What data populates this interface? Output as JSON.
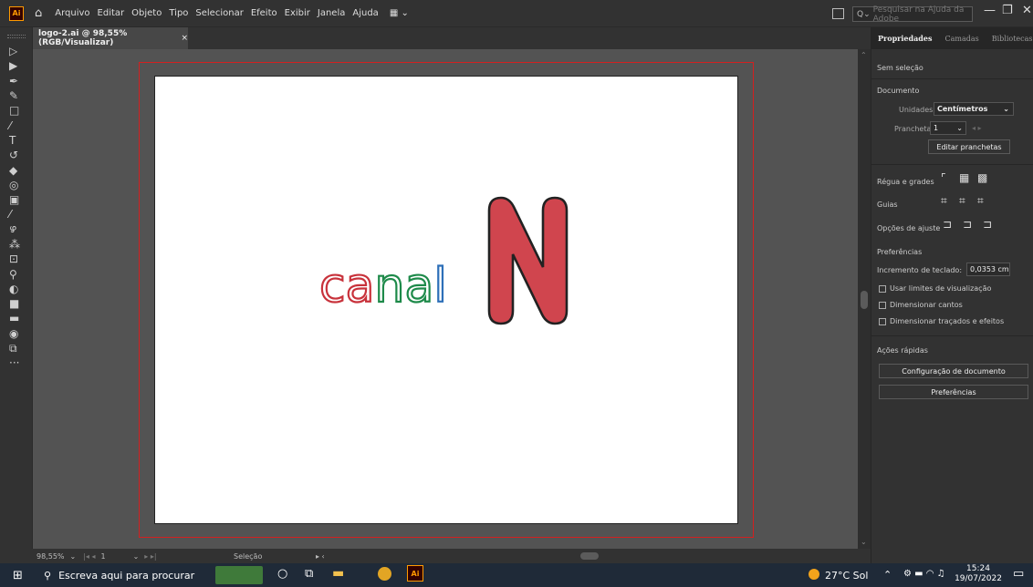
{
  "menubar": {
    "app_badge": "Ai",
    "items": [
      "Arquivo",
      "Editar",
      "Objeto",
      "Tipo",
      "Selecionar",
      "Efeito",
      "Exibir",
      "Janela",
      "Ajuda"
    ],
    "search_placeholder": "Pesquisar na Ajuda da Adobe"
  },
  "document": {
    "tab_title": "logo-2.ai @ 98,55% (RGB/Visualizar)",
    "close_glyph": "×",
    "logo_text": "canal",
    "logo_letter": "N",
    "colors": {
      "c": "#c8323b",
      "a1": "#c8323b",
      "n": "#1e8a4a",
      "a2": "#1e8a4a",
      "l": "#2d6fb8",
      "N_fill": "#d0454e",
      "outline": "#222222",
      "bleed": "#d32020"
    }
  },
  "statusbar": {
    "zoom": "98,55%",
    "artboard": "1",
    "tool": "Seleção"
  },
  "panel": {
    "tabs": [
      "Propriedades",
      "Camadas",
      "Bibliotecas"
    ],
    "no_selection": "Sem seleção",
    "document_heading": "Documento",
    "units_label": "Unidades:",
    "units_value": "Centímetros",
    "artboard_label": "Prancheta:",
    "artboard_value": "1",
    "edit_artboards": "Editar pranchetas",
    "rulers_label": "Régua e grades",
    "guides_label": "Guias",
    "snap_label": "Opções de ajuste",
    "prefs_heading": "Preferências",
    "keyboard_increment_label": "Incremento de teclado:",
    "keyboard_increment_value": "0,0353 cm",
    "checkboxes": [
      "Usar limites de visualização",
      "Dimensionar cantos",
      "Dimensionar traçados e efeitos"
    ],
    "quick_actions": "Ações rápidas",
    "doc_setup_button": "Configuração de documento",
    "prefs_button": "Preferências"
  },
  "taskbar": {
    "search_text": "Escreva aqui para procurar",
    "weather": "27°C Sol",
    "time": "15:24",
    "date": "19/07/2022"
  }
}
